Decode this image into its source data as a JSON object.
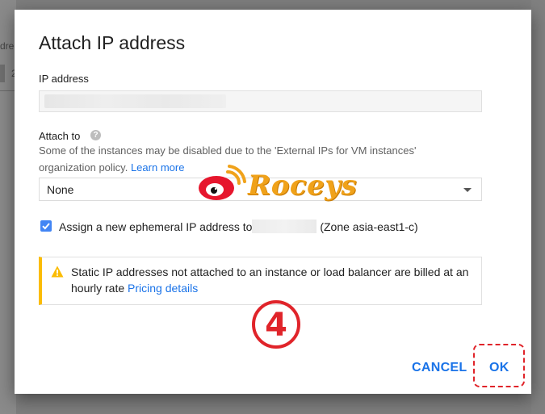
{
  "background": {
    "peek_text_1": "dre",
    "peek_text_2": "2"
  },
  "dialog": {
    "title": "Attach IP address",
    "ip_label": "IP address",
    "attach_label": "Attach to",
    "help_icon": "help-circle-icon",
    "hint_text": "Some of the instances may be disabled due to the 'External IPs for VM instances' organization policy.",
    "learn_more": "Learn more",
    "select_value": "None",
    "checkbox_checked": true,
    "checkbox_label_prefix": "Assign a new ephemeral IP address to",
    "checkbox_label_suffix": "(Zone asia-east1-c)",
    "warning_text": "Static IP addresses not attached to an instance or load balancer are billed at an hourly rate",
    "warning_link": "Pricing details",
    "cancel_label": "CANCEL",
    "ok_label": "OK"
  },
  "overlay": {
    "watermark_text": "Roceys",
    "step_number": "4"
  },
  "colors": {
    "accent": "#1a73e8",
    "warning": "#fbbc04",
    "checkbox": "#4285f4",
    "highlight": "#e0242a"
  }
}
